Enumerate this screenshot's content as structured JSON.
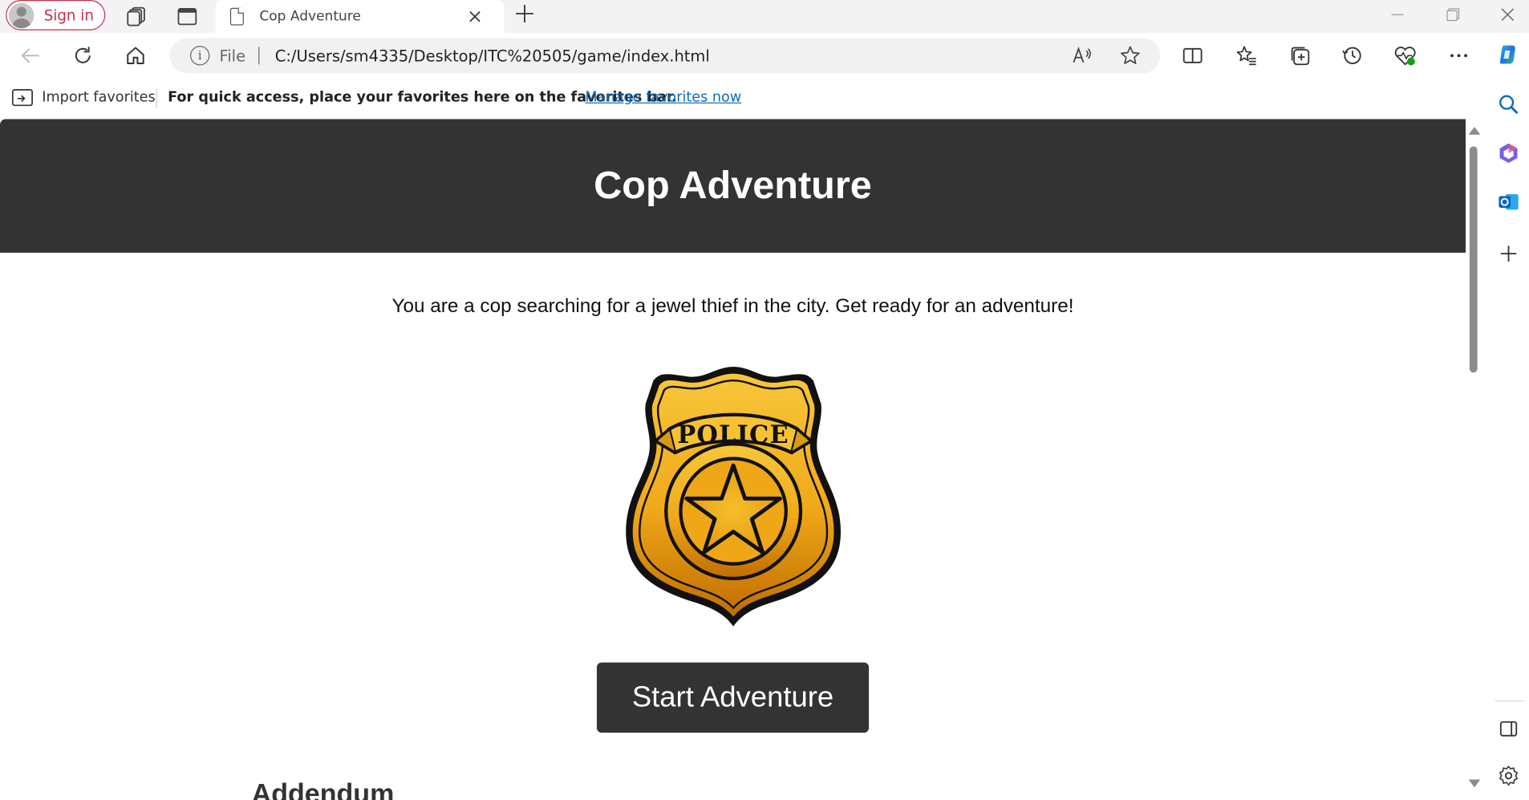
{
  "browser": {
    "sign_in_label": "Sign in",
    "tab_title": "Cop Adventure",
    "address_scheme": "File",
    "address_url": "C:/Users/sm4335/Desktop/ITC%20505/game/index.html",
    "info_glyph": "i",
    "favorites_bar": {
      "import_label": "Import favorites",
      "hint": "For quick access, place your favorites here on the favorites bar.",
      "manage_link": "Manage favorites now"
    },
    "icons": [
      "back-icon",
      "refresh-icon",
      "home-icon",
      "read-aloud-icon",
      "favorite-star-icon",
      "split-screen-icon",
      "favorites-icon",
      "collections-icon",
      "history-icon",
      "browser-essentials-icon",
      "more-icon",
      "copilot-icon",
      "search-icon",
      "office-icon",
      "outlook-icon",
      "add-icon",
      "sidebar-toggle-icon",
      "settings-icon"
    ]
  },
  "page": {
    "header_title": "Cop Adventure",
    "intro_text": "You are a cop searching for a jewel thief in the city. Get ready for an adventure!",
    "badge_text": "POLICE",
    "start_button_label": "Start Adventure",
    "addendum_heading": "Addendum"
  },
  "colors": {
    "header_bg": "#333333",
    "button_bg": "#333333",
    "badge_gold": "#f2b417",
    "badge_dark_gold": "#c87a00",
    "signin_accent": "#c4314b",
    "link": "#0f6cbd"
  }
}
